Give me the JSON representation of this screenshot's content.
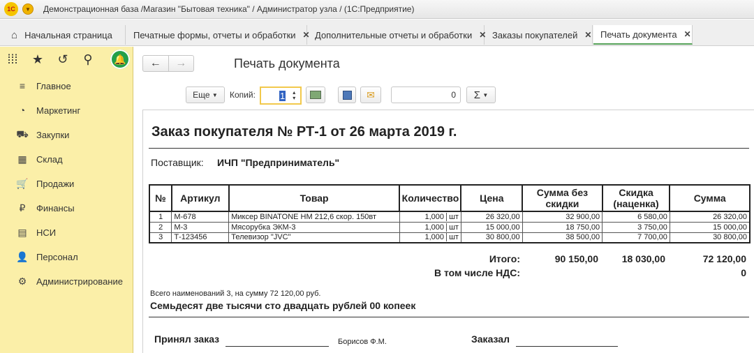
{
  "window": {
    "title": "Демонстрационная база /Магазин \"Бытовая техника\" / Администратор узла / (1С:Предприятие)",
    "logo_text": "1С"
  },
  "tabs": [
    {
      "label": "Начальная страница"
    },
    {
      "label": "Печатные формы, отчеты и обработки"
    },
    {
      "label": "Дополнительные отчеты и обработки"
    },
    {
      "label": "Заказы покупателей"
    },
    {
      "label": "Печать документа"
    }
  ],
  "tab_close_glyph": "✕",
  "sidebar": {
    "items": [
      {
        "label": "Главное",
        "icon": "menu-lines-icon"
      },
      {
        "label": "Маркетинг",
        "icon": "pie-chart-icon"
      },
      {
        "label": "Закупки",
        "icon": "truck-icon"
      },
      {
        "label": "Склад",
        "icon": "warehouse-icon"
      },
      {
        "label": "Продажи",
        "icon": "cart-icon"
      },
      {
        "label": "Финансы",
        "icon": "ruble-icon"
      },
      {
        "label": "НСИ",
        "icon": "book-icon"
      },
      {
        "label": "Персонал",
        "icon": "person-icon"
      },
      {
        "label": "Администрирование",
        "icon": "gear-icon"
      }
    ]
  },
  "page": {
    "title": "Печать документа"
  },
  "toolbar": {
    "more_label": "Еще",
    "copies_label": "Копий:",
    "copies_value": "1",
    "number_value": "0",
    "sum_label": "Σ"
  },
  "document": {
    "title": "Заказ покупателя № РТ-1 от 26 марта 2019 г.",
    "supplier_label": "Поставщик:",
    "supplier_value": "ИЧП \"Предприниматель\"",
    "columns": {
      "num": "№",
      "article": "Артикул",
      "product": "Товар",
      "qty": "Количество",
      "price": "Цена",
      "sum_no_discount": "Сумма без скидки",
      "discount": "Скидка (наценка)",
      "sum": "Сумма"
    },
    "rows": [
      {
        "num": "1",
        "article": "М-678",
        "product": "Миксер BINATONE HM 212,6 скор. 150вт",
        "qty": "1,000",
        "unit": "шт",
        "price": "26 320,00",
        "sum_no_discount": "32 900,00",
        "discount": "6 580,00",
        "sum": "26 320,00"
      },
      {
        "num": "2",
        "article": "М-3",
        "product": "Мясорубка ЭКМ-3",
        "qty": "1,000",
        "unit": "шт",
        "price": "15 000,00",
        "sum_no_discount": "18 750,00",
        "discount": "3 750,00",
        "sum": "15 000,00"
      },
      {
        "num": "3",
        "article": "Т-123456",
        "product": "Телевизор \"JVC\"",
        "qty": "1,000",
        "unit": "шт",
        "price": "30 800,00",
        "sum_no_discount": "38 500,00",
        "discount": "7 700,00",
        "sum": "30 800,00"
      }
    ],
    "totals": {
      "label": "Итого:",
      "sum_no_discount": "90 150,00",
      "discount": "18 030,00",
      "sum": "72 120,00",
      "vat_label": "В том числе НДС:",
      "vat_value": "0"
    },
    "summary_note": "Всего наименований 3, на сумму 72 120,00 руб.",
    "sum_in_words": "Семьдесят две тысячи сто двадцать рублей 00 копеек",
    "signatures": {
      "accepted_label": "Принял заказ",
      "accepted_name": "Борисов Ф.М.",
      "ordered_label": "Заказал"
    }
  }
}
